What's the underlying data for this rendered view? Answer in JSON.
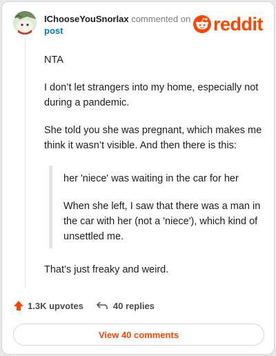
{
  "header": {
    "username": "IChooseYouSnorlax",
    "commented_text": "commented on",
    "post_link": "post",
    "logo_text": "reddit"
  },
  "comment": {
    "paragraphs": [
      "NTA",
      "I don’t let strangers into my home, especially not during a pandemic.",
      "She told you she was pregnant, which makes me think it wasn’t visible. And then there is this:"
    ],
    "quote": [
      "her 'niece' was waiting in the car for her",
      "When she left, I saw that there was a man in the car with her (not a 'niece'), which kind of unsettled me."
    ],
    "closing": "That’s just freaky and weird."
  },
  "actions": {
    "upvotes": "1.3K upvotes",
    "replies": "40 replies"
  },
  "view_button": "View 40 comments",
  "colors": {
    "brand": "#ff4500",
    "link": "#0079d3"
  }
}
